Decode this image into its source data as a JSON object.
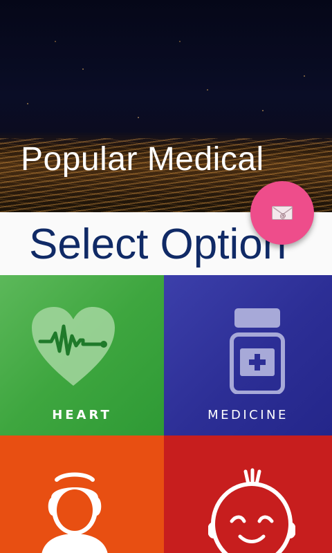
{
  "header": {
    "title": "Popular Medical"
  },
  "select": {
    "title": "Select Option"
  },
  "fab": {
    "icon": "email-icon",
    "color": "#ee4d8b"
  },
  "tiles": [
    {
      "label": "HEART",
      "icon": "heart-pulse-icon",
      "color": "#3ea63f"
    },
    {
      "label": "MEDICINE",
      "icon": "medicine-bottle-icon",
      "color": "#2c2e95"
    },
    {
      "label": "",
      "icon": "nurse-icon",
      "color": "#e84f12"
    },
    {
      "label": "",
      "icon": "baby-face-icon",
      "color": "#c71e1e"
    }
  ]
}
